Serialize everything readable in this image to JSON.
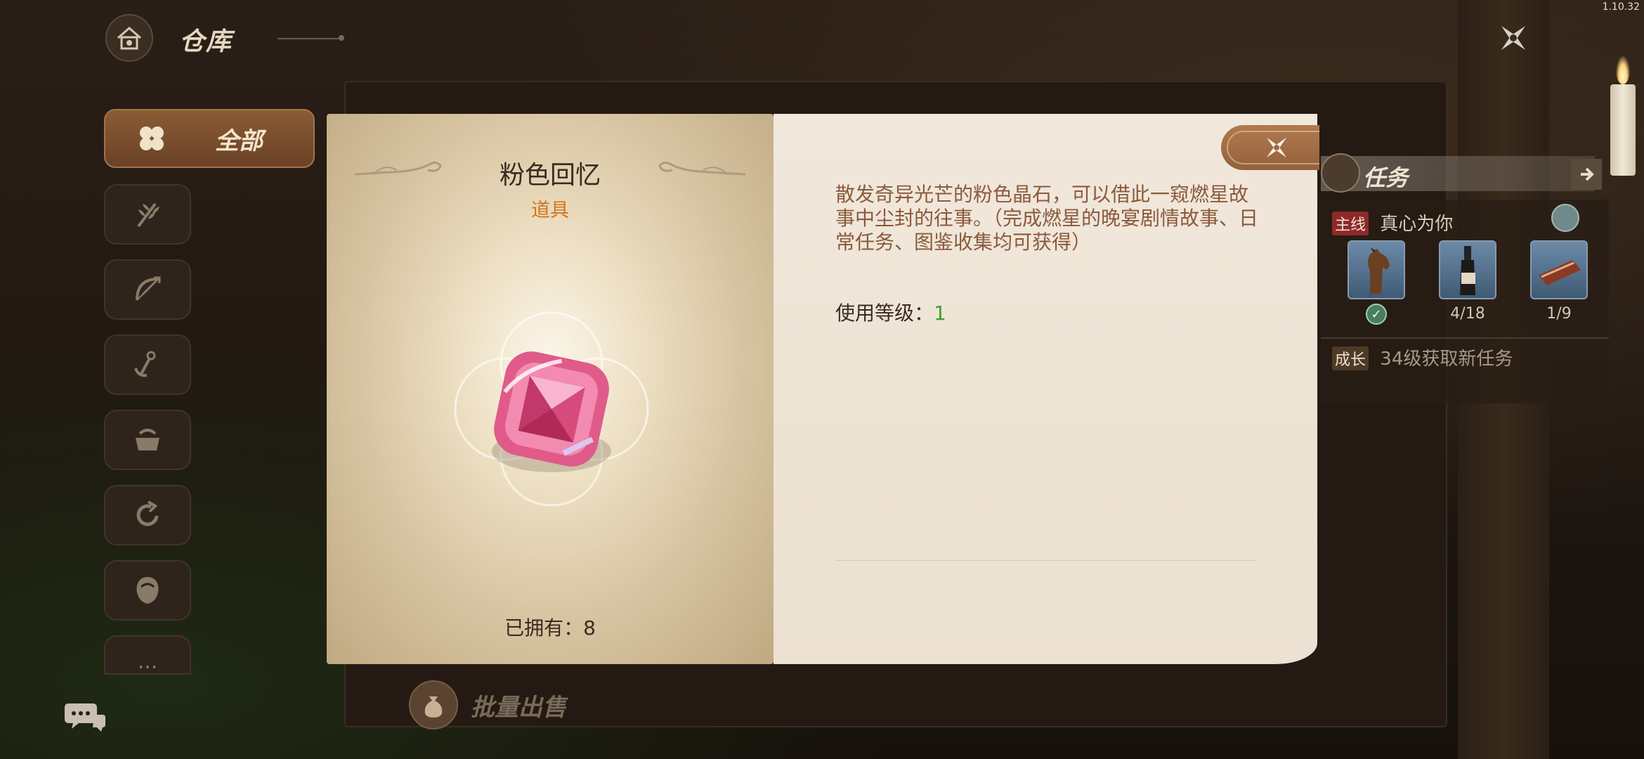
{
  "version": "1.10.32",
  "header": {
    "title": "仓库"
  },
  "sidebar": {
    "all_label": "全部",
    "categories": [
      {
        "icon": "wheat-icon"
      },
      {
        "icon": "bow-icon"
      },
      {
        "icon": "anchor-icon"
      },
      {
        "icon": "pot-icon"
      },
      {
        "icon": "refresh-icon"
      },
      {
        "icon": "head-icon"
      },
      {
        "icon": "more-icon",
        "label": "..."
      }
    ]
  },
  "footer": {
    "batch_sell_label": "批量出售"
  },
  "tasks": {
    "title": "任务",
    "main_tag": "主线",
    "main_name": "真心为你",
    "items": [
      {
        "icon": "horse-icon",
        "completed": true
      },
      {
        "icon": "wine-bottle-icon",
        "count": "4/18"
      },
      {
        "icon": "meat-icon",
        "count": "1/9"
      }
    ],
    "grow_tag": "成长",
    "grow_text": "34级获取新任务"
  },
  "modal": {
    "item_name": "粉色回忆",
    "item_type": "道具",
    "owned_label": "已拥有：8",
    "description": "散发奇异光芒的粉色晶石，可以借此一窥燃星故事中尘封的往事。（完成燃星的晚宴剧情故事、日常任务、图鉴收集均可获得）",
    "level_label": "使用等级：",
    "level_value": "1"
  },
  "colors": {
    "accent": "#d2751a",
    "desc": "#8b5a3c",
    "level": "#3da02a",
    "close_btn": "#a06b44"
  }
}
